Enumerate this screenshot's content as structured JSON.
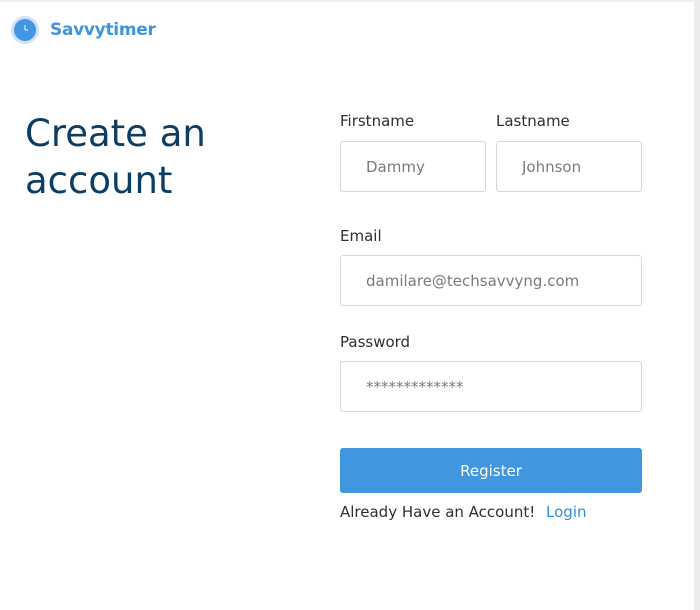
{
  "brand": {
    "name": "Savvytimer",
    "icon": "clock-icon",
    "color": "#3f93df"
  },
  "page": {
    "heading": "Create an account",
    "heading_color": "#0e3d63"
  },
  "form": {
    "firstname": {
      "label": "Firstname",
      "placeholder": "Dammy"
    },
    "lastname": {
      "label": "Lastname",
      "placeholder": "Johnson"
    },
    "email": {
      "label": "Email",
      "placeholder": "damilare@techsavvyng.com"
    },
    "password": {
      "label": "Password",
      "placeholder": "*************"
    },
    "register_label": "Register",
    "register_color": "#4096df"
  },
  "footer": {
    "prompt": "Already Have an Account!",
    "login_label": "Login"
  }
}
